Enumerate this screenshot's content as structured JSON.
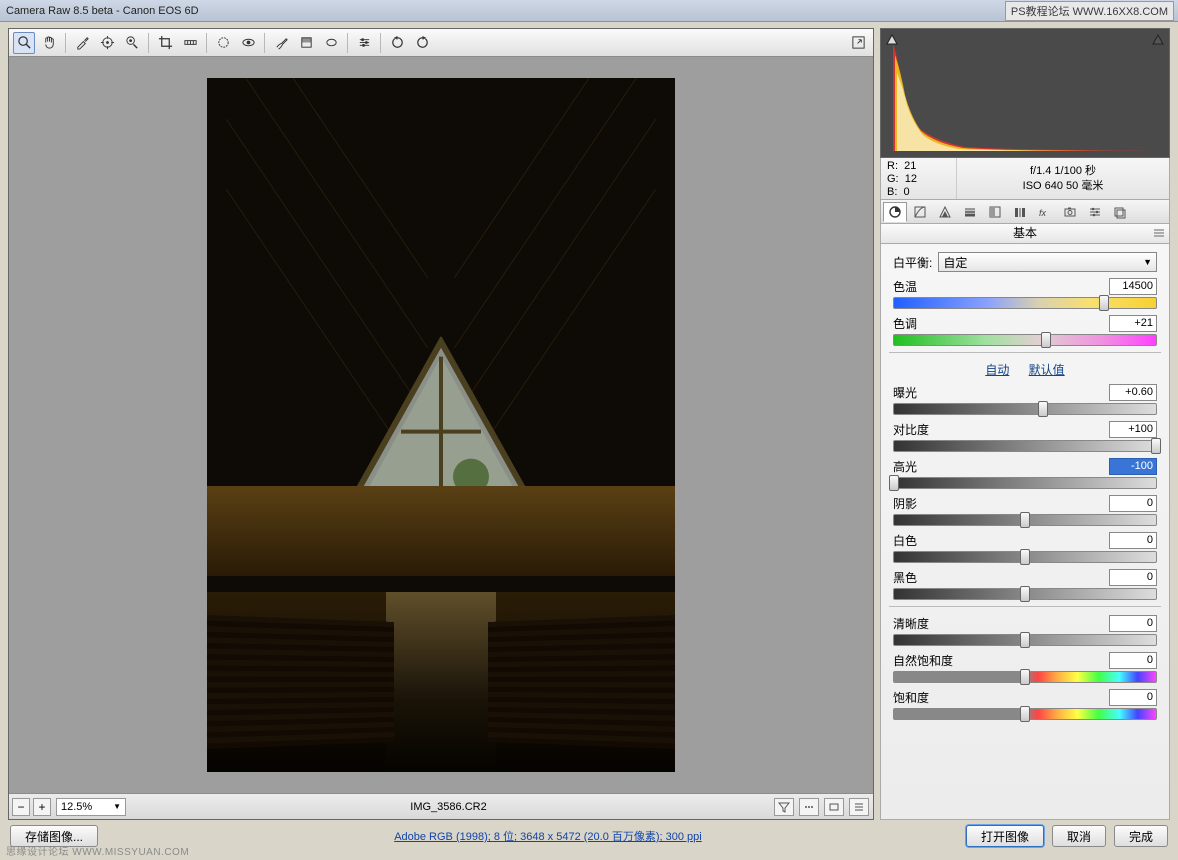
{
  "title": "Camera Raw 8.5 beta - Canon EOS 6D",
  "watermark_top": "PS教程论坛 WWW.16XX8.COM",
  "watermark_bottom": "思缘设计论坛  WWW.MISSYUAN.COM",
  "toolbar_icons": [
    "zoom",
    "hand",
    "eyedropper-wb",
    "color-sampler",
    "target-adjust",
    "crop",
    "straighten",
    "spot-removal",
    "redeye",
    "adjustment-brush",
    "graduated-filter",
    "radial-filter",
    "preferences",
    "rotate-ccw",
    "rotate-cw"
  ],
  "toolbar_right_icon": "toggle-fullscreen",
  "footer": {
    "zoom": "12.5%",
    "filename": "IMG_3586.CR2",
    "right_icons": [
      "filter",
      "rating",
      "label",
      "menu"
    ]
  },
  "rgb": {
    "r_label": "R:",
    "r": "21",
    "g_label": "G:",
    "g": "12",
    "b_label": "B:",
    "b": "0"
  },
  "exif": {
    "line1": "f/1.4   1/100 秒",
    "line2": "ISO 640   50 毫米"
  },
  "tab_icons": [
    "basic",
    "curve",
    "detail",
    "hsl",
    "split",
    "lens",
    "fx",
    "camera",
    "presets",
    "snapshots"
  ],
  "panel_title": "基本",
  "wb": {
    "label": "白平衡:",
    "value": "自定"
  },
  "sliders": {
    "temp": {
      "label": "色温",
      "value": "14500",
      "pos": 80,
      "track": "gradient-temp"
    },
    "tint": {
      "label": "色调",
      "value": "+21",
      "pos": 58,
      "track": "gradient-tint"
    },
    "exposure": {
      "label": "曝光",
      "value": "+0.60",
      "pos": 57,
      "track": "gray-track"
    },
    "contrast": {
      "label": "对比度",
      "value": "+100",
      "pos": 100,
      "track": "gray-track"
    },
    "highlights": {
      "label": "高光",
      "value": "-100",
      "pos": 0,
      "track": "gray-track",
      "selected": true
    },
    "shadows": {
      "label": "阴影",
      "value": "0",
      "pos": 50,
      "track": "gray-track"
    },
    "whites": {
      "label": "白色",
      "value": "0",
      "pos": 50,
      "track": "gray-track"
    },
    "blacks": {
      "label": "黑色",
      "value": "0",
      "pos": 50,
      "track": "gray-track"
    },
    "clarity": {
      "label": "清晰度",
      "value": "0",
      "pos": 50,
      "track": "gray-track"
    },
    "vibrance": {
      "label": "自然饱和度",
      "value": "0",
      "pos": 50,
      "track": "sat-track"
    },
    "saturation": {
      "label": "饱和度",
      "value": "0",
      "pos": 50,
      "track": "sat-track"
    }
  },
  "links": {
    "auto": "自动",
    "default": "默认值"
  },
  "buttons": {
    "save": "存储图像...",
    "open": "打开图像",
    "cancel": "取消",
    "done": "完成"
  },
  "bottom_info": "Adobe RGB (1998); 8 位;  3648 x 5472 (20.0 百万像素); 300 ppi"
}
